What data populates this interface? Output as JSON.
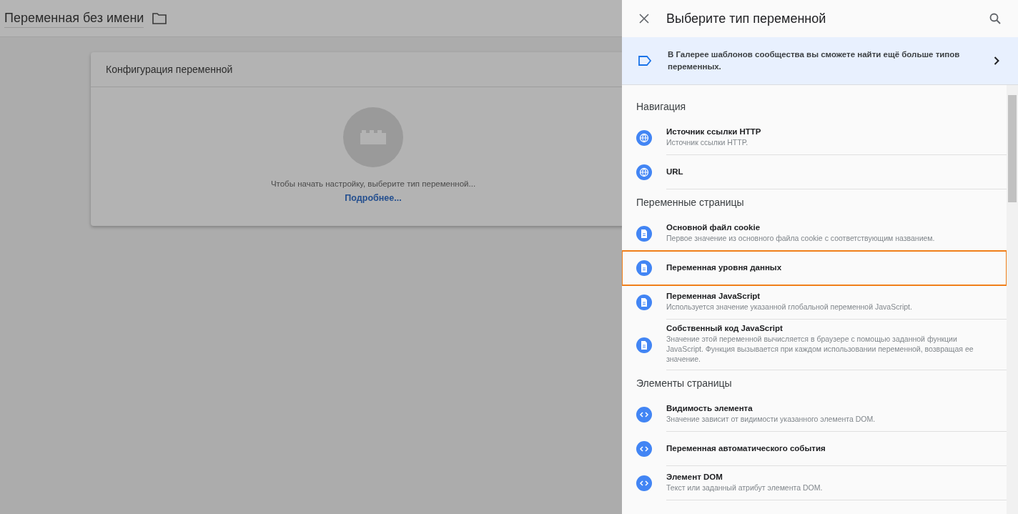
{
  "page": {
    "title": "Переменная без имени"
  },
  "config_card": {
    "title": "Конфигурация переменной",
    "hint": "Чтобы начать настройку, выберите тип переменной...",
    "link": "Подробнее..."
  },
  "panel": {
    "title": "Выберите тип переменной",
    "banner": "В Галерее шаблонов сообщества вы сможете найти ещё больше типов переменных.",
    "sections": [
      {
        "title": "Навигация",
        "items": [
          {
            "kind": "globe",
            "title": "Источник ссылки HTTP",
            "description": "Источник ссылки HTTP.",
            "highlighted": false
          },
          {
            "kind": "globe",
            "title": "URL",
            "highlighted": false
          }
        ]
      },
      {
        "title": "Переменные страницы",
        "items": [
          {
            "kind": "document",
            "title": "Основной файл cookie",
            "description": "Первое значение из основного файла cookie с соответствующим названием.",
            "highlighted": false
          },
          {
            "kind": "document",
            "title": "Переменная уровня данных",
            "highlighted": true
          },
          {
            "kind": "document",
            "title": "Переменная JavaScript",
            "description": "Используется значение указанной глобальной переменной JavaScript.",
            "highlighted": false
          },
          {
            "kind": "document",
            "title": "Собственный код JavaScript",
            "description": "Значение этой переменной вычисляется в браузере с помощью заданной функции JavaScript. Функция вызывается при каждом использовании переменной, возвращая ее значение.",
            "highlighted": false
          }
        ]
      },
      {
        "title": "Элементы страницы",
        "items": [
          {
            "kind": "code",
            "title": "Видимость элемента",
            "description": "Значение зависит от видимости указанного элемента DOM.",
            "highlighted": false
          },
          {
            "kind": "code",
            "title": "Переменная автоматического события",
            "highlighted": false
          },
          {
            "kind": "code",
            "title": "Элемент DOM",
            "description": "Текст или заданный атрибут элемента DOM.",
            "highlighted": false
          }
        ]
      }
    ]
  }
}
